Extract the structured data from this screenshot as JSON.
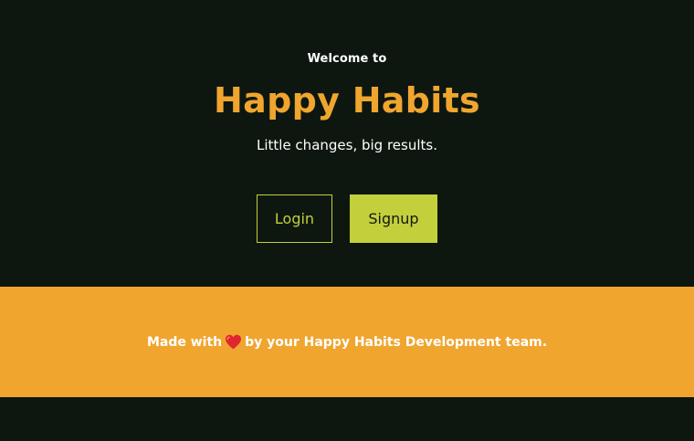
{
  "hero": {
    "welcome": "Welcome to",
    "title": "Happy Habits",
    "tagline": "Little changes, big results."
  },
  "actions": {
    "login_label": "Login",
    "signup_label": "Signup"
  },
  "footer": {
    "text_before": "Made with",
    "icon": "heart-icon",
    "text_after": "by your Happy Habits Development team."
  },
  "colors": {
    "background": "#0d1710",
    "accent_orange": "#f0a52f",
    "accent_lime": "#c4cf3c",
    "text_white": "#ffffff",
    "heart_red": "#e0262e"
  }
}
